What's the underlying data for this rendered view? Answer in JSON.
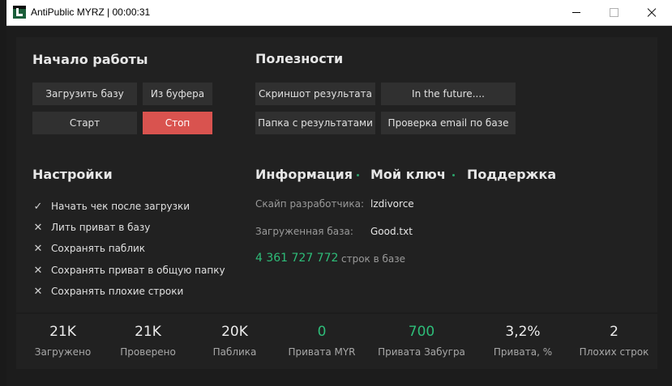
{
  "window": {
    "title": "AntiPublic MYRZ | 00:00:31"
  },
  "start": {
    "title": "Начало работы",
    "load_db": "Загрузить базу",
    "from_buffer": "Из буфера",
    "start": "Старт",
    "stop": "Стоп"
  },
  "utilities": {
    "title": "Полезности",
    "screenshot": "Скриншот результата",
    "future": "In the future....",
    "results_folder": "Папка с результатами",
    "email_check": "Проверка email по базе"
  },
  "settings": {
    "title": "Настройки",
    "options": [
      {
        "label": "Начать чек после загрузки",
        "checked": true,
        "mark": "✓"
      },
      {
        "label": "Лить приват в базу",
        "checked": false,
        "mark": "✕"
      },
      {
        "label": "Сохранять паблик",
        "checked": false,
        "mark": "✕"
      },
      {
        "label": "Сохранять приват в общую папку",
        "checked": false,
        "mark": "✕"
      },
      {
        "label": "Сохранять плохие строки",
        "checked": false,
        "mark": "✕"
      }
    ]
  },
  "info": {
    "tab_info": "Информация",
    "tab_key": "Мой ключ",
    "tab_support": "Поддержка",
    "skype_label": "Скайп разработчика:",
    "skype_value": "lzdivorce",
    "db_label": "Загруженная база:",
    "db_value": "Good.txt",
    "rows_count": "4 361 727 772",
    "rows_label": "строк в базе"
  },
  "stats": [
    {
      "value": "21K",
      "label": "Загружено"
    },
    {
      "value": "21K",
      "label": "Проверено"
    },
    {
      "value": "20K",
      "label": "Паблика"
    },
    {
      "value": "0",
      "label": "Привата MYR"
    },
    {
      "value": "700",
      "label": "Привата Забугра"
    },
    {
      "value": "3,2%",
      "label": "Привата, %"
    },
    {
      "value": "2",
      "label": "Плохих строк"
    }
  ],
  "colors": {
    "accent_green": "#2ebd79",
    "stop_red": "#d9534f",
    "bg": "#1c1c1c",
    "panel": "#212121",
    "button": "#303030"
  },
  "icons": {
    "check": "check-icon",
    "cross": "cross-icon",
    "app": "app-logo-icon"
  }
}
